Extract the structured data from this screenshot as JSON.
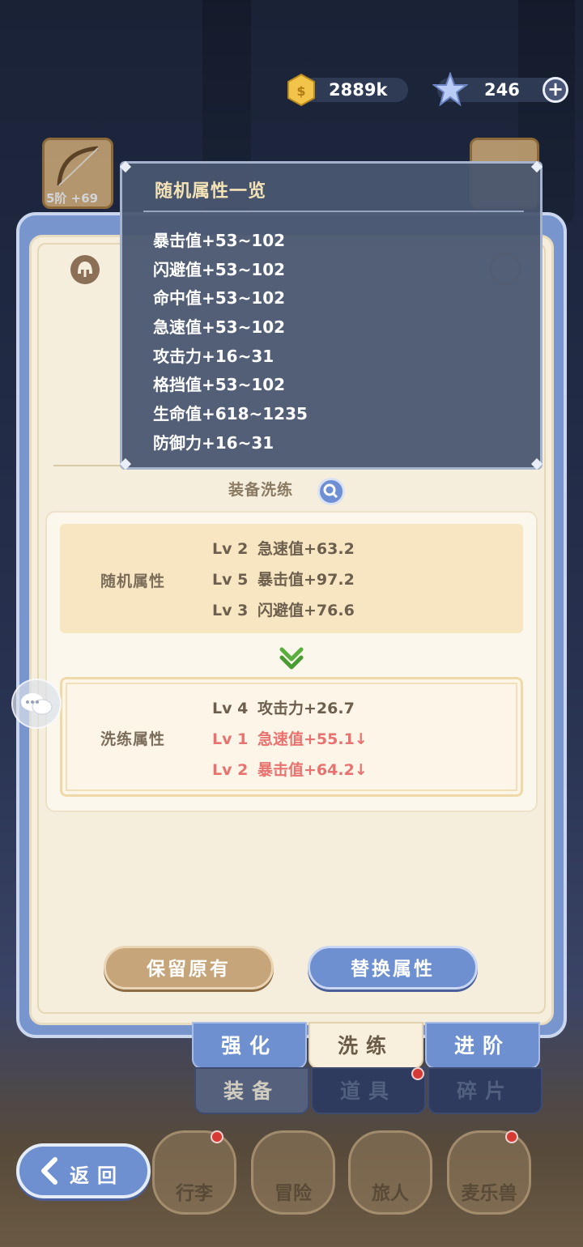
{
  "currency": {
    "gold": "2889k",
    "diamond": "246"
  },
  "background": {
    "slot_left_tag": "5阶 +69"
  },
  "tooltip": {
    "title": "随机属性一览",
    "items": [
      "暴击值+53~102",
      "闪避值+53~102",
      "命中值+53~102",
      "急速值+53~102",
      "攻击力+16~31",
      "格挡值+53~102",
      "生命值+618~1235",
      "防御力+16~31"
    ]
  },
  "panel": {
    "section_title": "装备洗练",
    "random": {
      "label": "随机属性",
      "stats": [
        {
          "lv": "Lv 2",
          "text": "急速值+63.2"
        },
        {
          "lv": "Lv 5",
          "text": "暴击值+97.2"
        },
        {
          "lv": "Lv 3",
          "text": "闪避值+76.6"
        }
      ]
    },
    "refine": {
      "label": "洗练属性",
      "stats": [
        {
          "lv": "Lv 4",
          "text": "攻击力+26.7"
        },
        {
          "lv": "Lv 1",
          "text": "急速值+55.1↓"
        },
        {
          "lv": "Lv 2",
          "text": "暴击值+64.2↓"
        }
      ]
    },
    "keep_button": "保留原有",
    "replace_button": "替换属性"
  },
  "tabs": {
    "top": [
      "强化",
      "洗练",
      "进阶"
    ],
    "bottom": [
      "装备",
      "道具",
      "碎片"
    ]
  },
  "nav": {
    "back": "返回",
    "items": [
      "行李",
      "冒险",
      "旅人",
      "麦乐兽"
    ]
  },
  "colors": {
    "accent_blue": "#6e8fd0",
    "accent_tan": "#c6a57a",
    "downgrade_red": "#e8726f",
    "tooltip_title": "#f3e2b6"
  }
}
